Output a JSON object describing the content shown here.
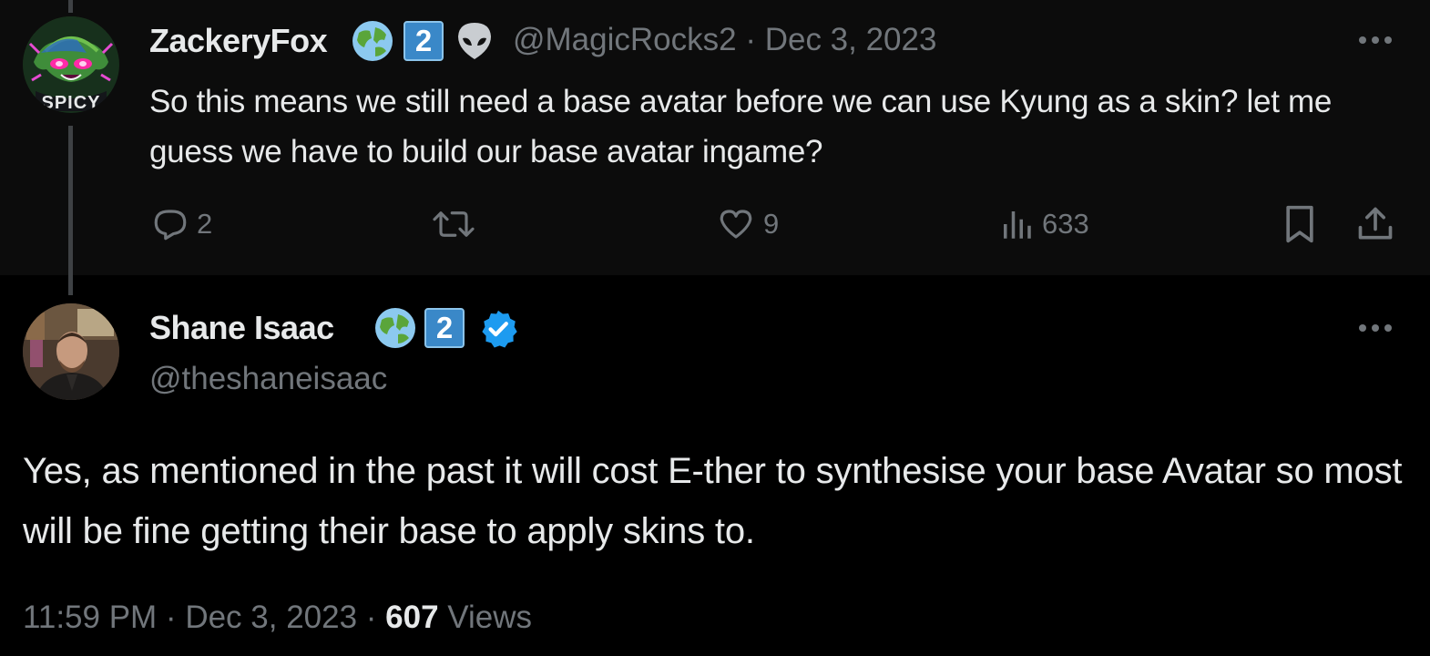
{
  "reply_tweet": {
    "display_name": "ZackeryFox",
    "name_badges": [
      "globe-emoji",
      "2",
      "alien-emoji"
    ],
    "handle_date": "@MagicRocks2 · Dec 3, 2023",
    "text": "So this means we still need a base avatar before we can use Kyung as a skin? let me guess we have to build our base avatar ingame?",
    "avatar_label": "SPICY",
    "actions": {
      "replies": "2",
      "retweets": "",
      "likes": "9",
      "views": "633"
    }
  },
  "main_tweet": {
    "display_name": "Shane Isaac",
    "name_badges": [
      "globe-emoji",
      "2",
      "verified-badge"
    ],
    "handle": "@theshaneisaac",
    "text": "Yes, as mentioned in the past it will cost E-ther to synthesise your base Avatar so most will be fine getting their base to apply skins to.",
    "time_date": "11:59 PM · Dec 3, 2023 · ",
    "views_count": "607",
    "views_label": " Views"
  },
  "colors": {
    "background": "#000000",
    "top_tweet_background": "#0c0c0c",
    "text_primary": "#e7e9ea",
    "text_secondary": "#71767b",
    "verified_blue": "#1d9bf0",
    "number_badge_blue": "#3a88c8"
  }
}
